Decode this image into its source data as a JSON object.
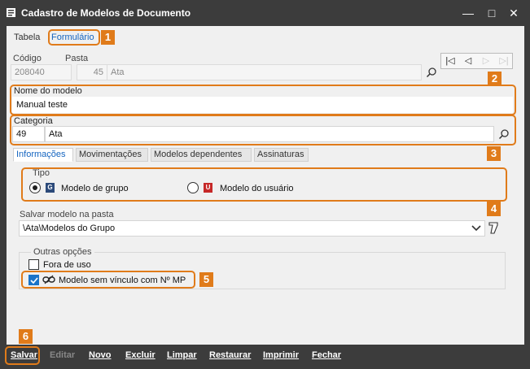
{
  "window": {
    "title": "Cadastro de Modelos de Documento",
    "minimize_label": "—",
    "maximize_label": "□",
    "close_label": "✕"
  },
  "tabs": {
    "tabela": "Tabela",
    "formulario": "Formulário"
  },
  "codigo": {
    "label": "Código",
    "value": "208040"
  },
  "pasta": {
    "label": "Pasta",
    "number": "45",
    "name": "Ata"
  },
  "nav": {
    "first": "|◁",
    "prev": "◁",
    "next": "▷",
    "last": "▷|"
  },
  "nome_modelo": {
    "label": "Nome do modelo",
    "value": "Manual teste"
  },
  "categoria": {
    "label": "Categoria",
    "code": "49",
    "name": "Ata"
  },
  "subtabs": {
    "informacoes": "Informações",
    "movimentacoes": "Movimentações",
    "modelos_dependentes": "Modelos dependentes",
    "assinaturas": "Assinaturas"
  },
  "tipo": {
    "label": "Tipo",
    "grupo_label": "Modelo de grupo",
    "grupo_badge": "G",
    "grupo_selected": true,
    "usuario_label": "Modelo do usuário",
    "usuario_badge": "U"
  },
  "salvar_pasta": {
    "label": "Salvar modelo na pasta",
    "value": "\\Ata\\Modelos do Grupo"
  },
  "outras_opcoes": {
    "label": "Outras opções",
    "fora_de_uso": "Fora de uso",
    "sem_vinculo": "Modelo sem vínculo com Nº MP"
  },
  "callouts": [
    "1",
    "2",
    "3",
    "4",
    "5",
    "6"
  ],
  "toolbar": {
    "salvar": "Salvar",
    "editar": "Editar",
    "novo": "Novo",
    "excluir": "Excluir",
    "limpar": "Limpar",
    "restaurar": "Restaurar",
    "imprimir": "Imprimir",
    "fechar": "Fechar"
  },
  "colors": {
    "highlight": "#e07b1a",
    "accent": "#1565c0",
    "titlebar": "#3c3c3c"
  }
}
